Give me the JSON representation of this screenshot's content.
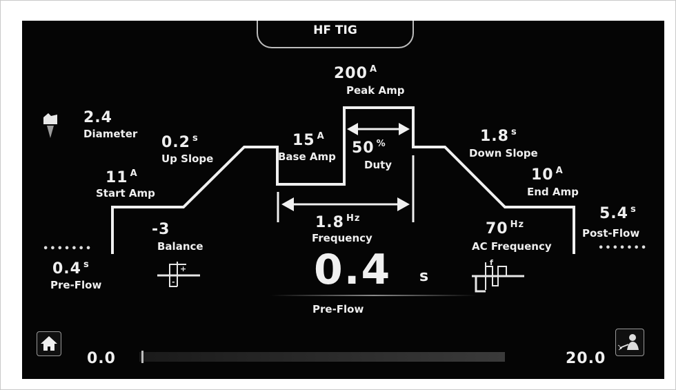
{
  "header": {
    "title": "HF TIG"
  },
  "params": {
    "peak_amp": {
      "value": "200",
      "unit": "A",
      "label": "Peak Amp"
    },
    "diameter": {
      "value": "2.4",
      "label": "Diameter"
    },
    "up_slope": {
      "value": "0.2",
      "unit": "s",
      "label": "Up Slope"
    },
    "base_amp": {
      "value": "15",
      "unit": "A",
      "label": "Base Amp"
    },
    "duty": {
      "value": "50",
      "unit": "%",
      "label": "Duty"
    },
    "down_slope": {
      "value": "1.8",
      "unit": "s",
      "label": "Down Slope"
    },
    "start_amp": {
      "value": "11",
      "unit": "A",
      "label": "Start Amp"
    },
    "end_amp": {
      "value": "10",
      "unit": "A",
      "label": "End Amp"
    },
    "post_flow": {
      "value": "5.4",
      "unit": "s",
      "label": "Post-Flow"
    },
    "frequency": {
      "value": "1.8",
      "unit": "Hz",
      "label": "Frequency"
    },
    "balance": {
      "value": "-3",
      "label": "Balance"
    },
    "ac_frequency": {
      "value": "70",
      "unit": "Hz",
      "label": "AC Frequency"
    },
    "pre_flow": {
      "value": "0.4",
      "unit": "s",
      "label": "Pre-Flow"
    }
  },
  "main_readout": {
    "value": "0.4",
    "unit": "s",
    "label": "Pre-Flow"
  },
  "slider": {
    "min": "0.0",
    "max": "20.0",
    "fraction": 0.02
  },
  "dots": "•••••••",
  "icons": {
    "home": "home-icon",
    "welder": "welder-icon",
    "electrode": "electrode-icon",
    "balance": "balance-waveform-icon",
    "ac": "ac-frequency-waveform-icon"
  }
}
